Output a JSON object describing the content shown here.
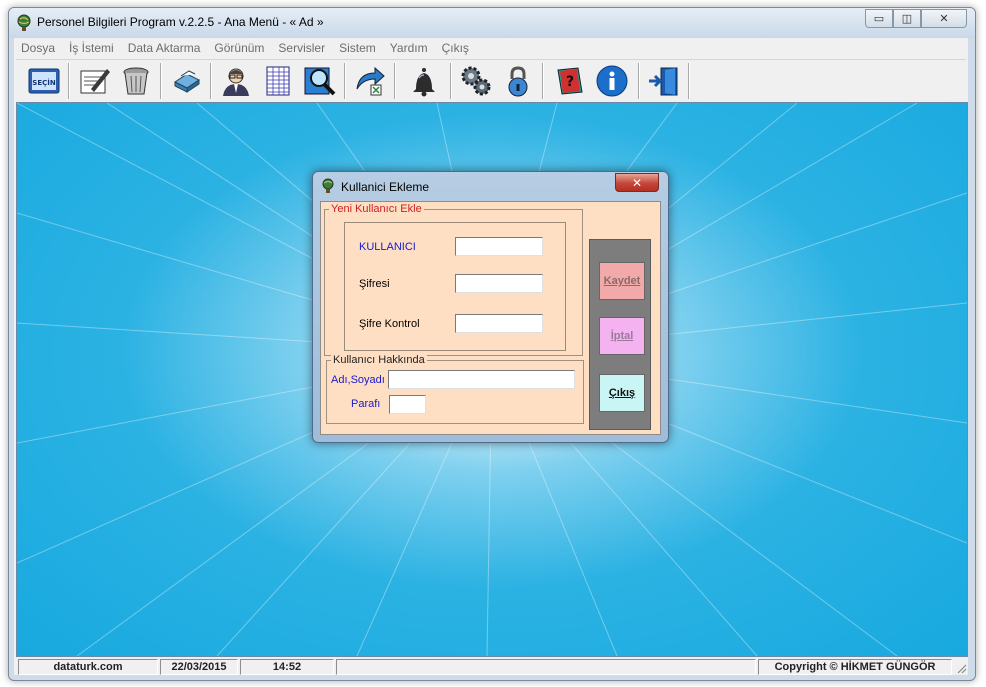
{
  "window": {
    "title": "Personel Bilgileri Program v.2.2.5  - Ana Menü -  « Ad »",
    "controls": {
      "minimize": "▭",
      "restore": "◫",
      "close": "✕"
    }
  },
  "menu": [
    {
      "label": "Dosya"
    },
    {
      "label": "İş İstemi"
    },
    {
      "label": "Data Aktarma"
    },
    {
      "label": "Görünüm"
    },
    {
      "label": "Servisler"
    },
    {
      "label": "Sistem"
    },
    {
      "label": "Yardım"
    },
    {
      "label": "Çıkış"
    }
  ],
  "toolbar": {
    "buttons": [
      {
        "icon": "secin-book-icon",
        "text": "SEÇİN"
      },
      {
        "icon": "notepad-write-icon"
      },
      {
        "icon": "trash-bin-icon"
      },
      {
        "icon": "printer-icon"
      },
      {
        "icon": "person-icon"
      },
      {
        "icon": "spreadsheet-icon"
      },
      {
        "icon": "magnifier-icon"
      },
      {
        "icon": "export-arrow-icon"
      },
      {
        "icon": "bell-icon"
      },
      {
        "icon": "gears-icon"
      },
      {
        "icon": "padlock-icon"
      },
      {
        "icon": "help-book-icon"
      },
      {
        "icon": "info-icon"
      },
      {
        "icon": "exit-door-icon"
      }
    ]
  },
  "dialog": {
    "title": "Kullanici Ekleme",
    "close": "✕",
    "new_user_group": {
      "label": "Yeni Kullanıcı Ekle",
      "fields": [
        {
          "label": "KULLANICI",
          "value": ""
        },
        {
          "label": "Şifresi",
          "value": ""
        },
        {
          "label": "Şifre Kontrol",
          "value": ""
        }
      ]
    },
    "about_group": {
      "label": "Kullanıcı Hakkında",
      "name_label": "Adı,Soyadı",
      "name_value": "",
      "initials_label": "Parafı",
      "initials_value": ""
    },
    "buttons": {
      "save": "Kaydet",
      "cancel": "İptal",
      "exit": "Çıkış"
    },
    "colors": {
      "label_blue": "#1a1acc",
      "group_red": "#cc2020",
      "body": "#fedfc4"
    }
  },
  "status": {
    "site": "dataturk.com",
    "date": "22/03/2015",
    "time": "14:52",
    "copyright": "Copyright © HİKMET GÜNGÖR"
  }
}
